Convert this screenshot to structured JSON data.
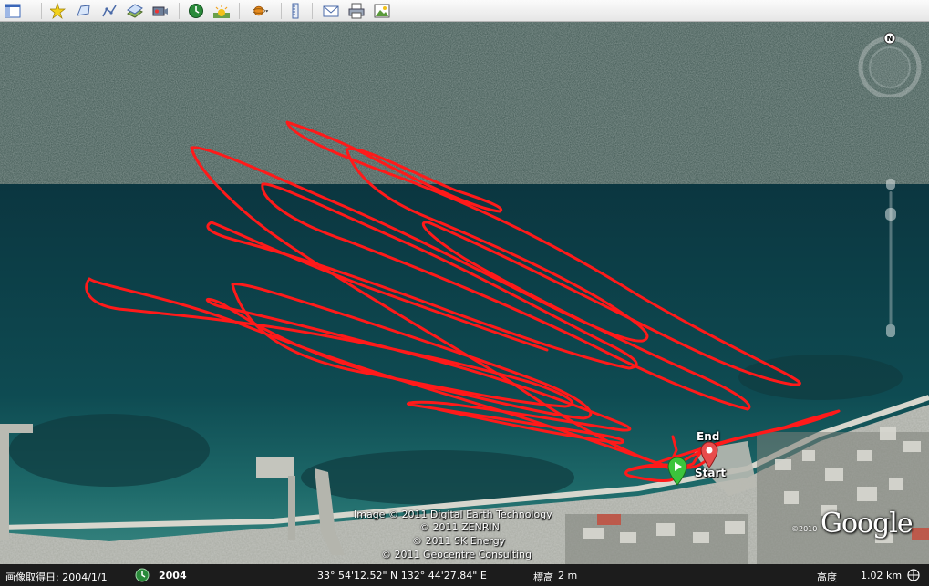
{
  "toolbar": {
    "buttons": [
      {
        "name": "sidebar-toggle-button",
        "icon": "sidebar-icon"
      },
      {
        "name": "add-placemark-button",
        "icon": "placemark-icon"
      },
      {
        "name": "add-polygon-button",
        "icon": "polygon-icon"
      },
      {
        "name": "add-path-button",
        "icon": "path-icon"
      },
      {
        "name": "add-image-overlay-button",
        "icon": "image-overlay-icon"
      },
      {
        "name": "record-tour-button",
        "icon": "record-tour-icon"
      },
      {
        "name": "historical-imagery-button",
        "icon": "clock-icon"
      },
      {
        "name": "sunlight-button",
        "icon": "sun-icon"
      },
      {
        "name": "switch-planet-button",
        "icon": "planet-icon"
      },
      {
        "name": "ruler-button",
        "icon": "ruler-icon"
      },
      {
        "name": "email-button",
        "icon": "email-icon"
      },
      {
        "name": "print-button",
        "icon": "print-icon"
      },
      {
        "name": "save-image-button",
        "icon": "save-image-icon"
      }
    ]
  },
  "map": {
    "labels": {
      "end": "End",
      "start": "Start"
    },
    "compass_north": "N",
    "credits": [
      "Image © 2011 Digital Earth Technology",
      "© 2011 ZENRIN",
      "© 2011 SK Energy",
      "© 2011 Geocentre Consulting"
    ],
    "logo_text": "Google",
    "logo_year": "©2010",
    "track_color": "#ff1a1a",
    "start_pin_color": "#3cc43c",
    "end_pin_color": "#e84c4c"
  },
  "status": {
    "imagery_date_label": "画像取得日: 2004/1/1",
    "timeline_year": "2004",
    "coordinates": "33° 54'12.52\" N 132° 44'27.84\" E",
    "elevation_label": "標高",
    "elevation_value": "2 m",
    "eye_alt_label": "高度",
    "eye_alt_value": "1.02 km"
  }
}
